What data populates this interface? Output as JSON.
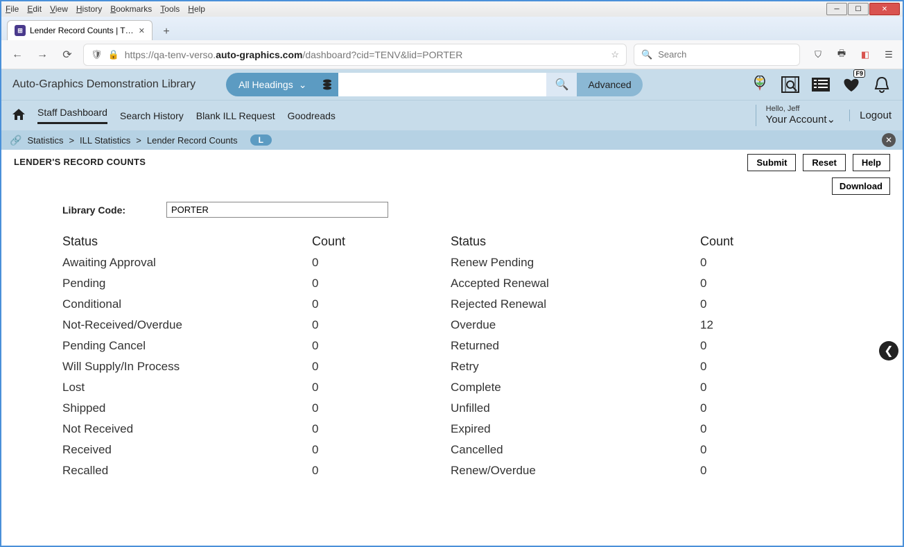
{
  "menubar": [
    "File",
    "Edit",
    "View",
    "History",
    "Bookmarks",
    "Tools",
    "Help"
  ],
  "tab": {
    "title": "Lender Record Counts | TENV |"
  },
  "url": {
    "prefix": "https://qa-tenv-verso.",
    "bold": "auto-graphics.com",
    "suffix": "/dashboard?cid=TENV&lid=PORTER"
  },
  "browser_search_placeholder": "Search",
  "app": {
    "library_name": "Auto-Graphics Demonstration Library",
    "dropdown": "All Headings",
    "advanced": "Advanced",
    "heart_badge": "F9"
  },
  "nav": {
    "items": [
      "Staff Dashboard",
      "Search History",
      "Blank ILL Request",
      "Goodreads"
    ],
    "hello": "Hello, Jeff",
    "account": "Your Account",
    "logout": "Logout"
  },
  "breadcrumb": {
    "parts": [
      "Statistics",
      "ILL Statistics",
      "Lender Record Counts"
    ],
    "pill": "L"
  },
  "page": {
    "title": "LENDER'S RECORD COUNTS",
    "submit": "Submit",
    "reset": "Reset",
    "help": "Help",
    "download": "Download",
    "library_code_label": "Library Code:",
    "library_code_value": "PORTER",
    "status_hdr": "Status",
    "count_hdr": "Count",
    "left_rows": [
      {
        "status": "Awaiting Approval",
        "count": "0"
      },
      {
        "status": "Pending",
        "count": "0"
      },
      {
        "status": "Conditional",
        "count": "0"
      },
      {
        "status": "Not-Received/Overdue",
        "count": "0"
      },
      {
        "status": "Pending Cancel",
        "count": "0"
      },
      {
        "status": "Will Supply/In Process",
        "count": "0"
      },
      {
        "status": "Lost",
        "count": "0"
      },
      {
        "status": "Shipped",
        "count": "0"
      },
      {
        "status": "Not Received",
        "count": "0"
      },
      {
        "status": "Received",
        "count": "0"
      },
      {
        "status": "Recalled",
        "count": "0"
      }
    ],
    "right_rows": [
      {
        "status": "Renew Pending",
        "count": "0"
      },
      {
        "status": "Accepted Renewal",
        "count": "0"
      },
      {
        "status": "Rejected Renewal",
        "count": "0"
      },
      {
        "status": "Overdue",
        "count": "12"
      },
      {
        "status": "Returned",
        "count": "0"
      },
      {
        "status": "Retry",
        "count": "0"
      },
      {
        "status": "Complete",
        "count": "0"
      },
      {
        "status": "Unfilled",
        "count": "0"
      },
      {
        "status": "Expired",
        "count": "0"
      },
      {
        "status": "Cancelled",
        "count": "0"
      },
      {
        "status": "Renew/Overdue",
        "count": "0"
      }
    ]
  }
}
